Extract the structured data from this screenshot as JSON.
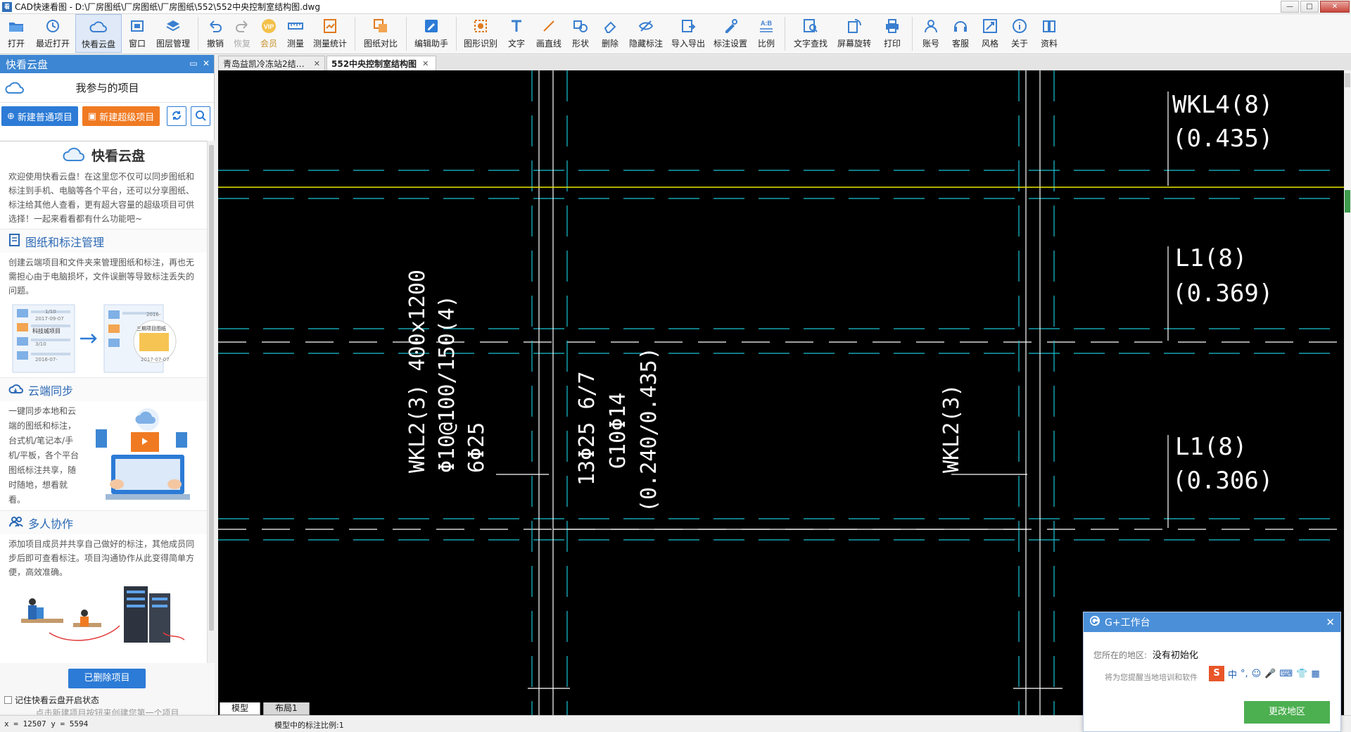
{
  "window": {
    "title": "CAD快速看图 - D:\\厂房图纸\\厂房图纸\\厂房图纸\\552\\552中央控制室结构图.dwg",
    "logo_text": "看",
    "min_symbol": "—",
    "max_symbol": "□",
    "close_symbol": "✕"
  },
  "toolbar": {
    "items": [
      {
        "label": "打开",
        "icon": "folder-open-icon"
      },
      {
        "label": "最近打开",
        "icon": "history-icon"
      },
      {
        "label": "快看云盘",
        "icon": "cloud-icon"
      },
      {
        "label": "窗口",
        "icon": "window-icon"
      },
      {
        "label": "图层管理",
        "icon": "layers-icon"
      },
      {
        "label": "撤销",
        "icon": "undo-icon"
      },
      {
        "label": "恢复",
        "icon": "redo-icon"
      },
      {
        "label": "会员",
        "icon": "vip-icon",
        "vip_text": "VIP"
      },
      {
        "label": "测量",
        "icon": "ruler-icon"
      },
      {
        "label": "测量统计",
        "icon": "measure-stats-icon"
      },
      {
        "label": "图纸对比",
        "icon": "compare-icon"
      },
      {
        "label": "编辑助手",
        "icon": "edit-assistant-icon"
      },
      {
        "label": "图形识别",
        "icon": "shape-recognize-icon"
      },
      {
        "label": "文字",
        "icon": "text-icon"
      },
      {
        "label": "画直线",
        "icon": "line-icon"
      },
      {
        "label": "形状",
        "icon": "shape-icon"
      },
      {
        "label": "删除",
        "icon": "eraser-icon"
      },
      {
        "label": "隐藏标注",
        "icon": "hide-annotation-icon"
      },
      {
        "label": "导入导出",
        "icon": "import-export-icon"
      },
      {
        "label": "标注设置",
        "icon": "annotation-settings-icon"
      },
      {
        "label": "比例",
        "icon": "scale-icon",
        "scale_text": "A:B"
      },
      {
        "label": "文字查找",
        "icon": "text-search-icon"
      },
      {
        "label": "屏幕旋转",
        "icon": "rotate-icon"
      },
      {
        "label": "打印",
        "icon": "printer-icon"
      },
      {
        "label": "账号",
        "icon": "user-icon"
      },
      {
        "label": "客服",
        "icon": "headset-icon"
      },
      {
        "label": "风格",
        "icon": "style-icon"
      },
      {
        "label": "关于",
        "icon": "info-icon"
      },
      {
        "label": "资料",
        "icon": "resources-icon"
      }
    ]
  },
  "left_panel": {
    "title": "快看云盘",
    "subtitle": "我参与的项目",
    "new_normal": "新建普通项目",
    "new_super": "新建超级项目",
    "intro_title": "快看云盘",
    "intro_text": "欢迎使用快看云盘！在这里您不仅可以同步图纸和标注到手机、电脑等各个平台，还可以分享图纸、标注给其他人查看，更有超大容量的超级项目可供选择！一起来看看都有什么功能吧~",
    "sections": [
      {
        "title": "图纸和标注管理",
        "text": "创建云端项目和文件夹来管理图纸和标注，再也无需担心由于电脑损坏，文件误删等导致标注丢失的问题。"
      },
      {
        "title": "云端同步",
        "text": "一键同步本地和云端的图纸和标注，台式机/笔记本/手机/平板，各个平台图纸标注共享，随时随地，想看就看。"
      },
      {
        "title": "多人协作",
        "text": "添加项目成员并共享自己做好的标注，其他成员同步后即可查看标注。项目沟通协作从此变得简单方便，高效准确。"
      }
    ],
    "illus_labels": {
      "date1": "2017-09-07",
      "count1": "1/10",
      "name1": "科技城项目",
      "date2": "2016-07-",
      "count2": "3/10",
      "folder": "三期项目图纸",
      "date3": "2017-07-07",
      "date4": "2016-"
    },
    "deleted_button": "已删除项目",
    "remember_label": "记住快看云盘开启状态",
    "hint": "点击新建项目按钮来创建您第一个项目"
  },
  "tabs": [
    {
      "label": "青岛益凯冷冻站2结构…",
      "active": false
    },
    {
      "label": "552中央控制室结构图",
      "active": true
    }
  ],
  "model_tabs": [
    {
      "label": "模型",
      "active": true
    },
    {
      "label": "布局1",
      "active": false
    }
  ],
  "drawing": {
    "labels": {
      "wkl4_a": "WKL4(8)",
      "wkl4_b": "(0.435)",
      "l1a_a": "L1(8)",
      "l1a_b": "(0.369)",
      "l1b_a": "L1(8)",
      "l1b_b": "(0.306)",
      "wkl2_left_1": "WKL2(3) 400x1200",
      "wkl2_left_2": "Φ10@100/150(4)",
      "wkl2_left_3": "6Φ25",
      "col_1": "13Φ25 6/7",
      "col_2": "G10Φ14",
      "col_3": "(0.240/0.435)",
      "wkl2_right": "WKL2(3)"
    },
    "colors": {
      "background": "#000000",
      "grid": "#19c4d4",
      "axis": "#e8e800",
      "text": "#ffffff"
    }
  },
  "status": {
    "coords": "x = 12507  y = 5594",
    "scale_text": "模型中的标注比例:1"
  },
  "popup": {
    "title": "G+工作台",
    "region_label": "您所在的地区:",
    "region_value": "没有初始化",
    "sub_text": "将为您提醒当地培训和软件",
    "ime": [
      "中",
      "°,",
      "☺",
      "🎤",
      "⌨",
      "👕",
      "▦"
    ],
    "change_button": "更改地区",
    "close_symbol": "✕"
  }
}
